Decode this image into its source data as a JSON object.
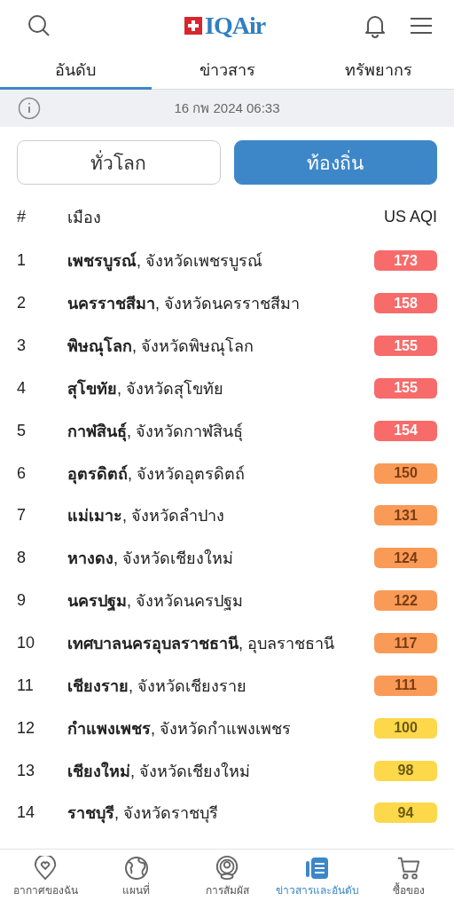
{
  "header": {
    "logo": "IQAir"
  },
  "tabs": [
    {
      "label": "อันดับ",
      "selected": true
    },
    {
      "label": "ข่าวสาร",
      "selected": false
    },
    {
      "label": "ทรัพยากร",
      "selected": false
    }
  ],
  "timestamp": "16 กพ 2024 06:33",
  "scope_toggle": [
    {
      "label": "ทั่วโลก",
      "selected": false
    },
    {
      "label": "ท้องถิ่น",
      "selected": true
    }
  ],
  "table": {
    "columns": [
      "#",
      "เมือง",
      "US AQI"
    ],
    "rows": [
      {
        "rank": "1",
        "city": "**เพชรบูรณ์**, จังหวัดเพชรบูรณ์",
        "aqi": "173",
        "color": "#f76b6b"
      },
      {
        "rank": "2",
        "city": "**นครราชสีมา**, จังหวัดนครราชสีมา",
        "aqi": "158",
        "color": "#f76b6b"
      },
      {
        "rank": "3",
        "city": "**พิษณุโลก**, จังหวัดพิษณุโลก",
        "aqi": "155",
        "color": "#f76b6b"
      },
      {
        "rank": "4",
        "city": "**สุโขทัย**, จังหวัดสุโขทัย",
        "aqi": "155",
        "color": "#f76b6b"
      },
      {
        "rank": "5",
        "city": "**กาฬสินธุ์**, จังหวัดกาฬสินธุ์",
        "aqi": "154",
        "color": "#f76b6b"
      },
      {
        "rank": "6",
        "city": "**อุตรดิตถ์**, จังหวัดอุตรดิตถ์",
        "aqi": "150",
        "color": "#fa9a57"
      },
      {
        "rank": "7",
        "city": "**แม่เมาะ**, จังหวัดลำปาง",
        "aqi": "131",
        "color": "#fa9a57"
      },
      {
        "rank": "8",
        "city": "**หางดง**, จังหวัดเชียงใหม่",
        "aqi": "124",
        "color": "#fa9a57"
      },
      {
        "rank": "9",
        "city": "**นครปฐม**, จังหวัดนครปฐม",
        "aqi": "122",
        "color": "#fa9a57"
      },
      {
        "rank": "10",
        "city": "**เทศบาลนครอุบลราชธานี**, อุบลราชธานี",
        "aqi": "117",
        "color": "#fa9a57"
      },
      {
        "rank": "11",
        "city": "**เชียงราย**, จังหวัดเชียงราย",
        "aqi": "111",
        "color": "#fa9a57"
      },
      {
        "rank": "12",
        "city": "**กำแพงเพชร**, จังหวัดกำแพงเพชร",
        "aqi": "100",
        "color": "#fcd84a"
      },
      {
        "rank": "13",
        "city": "**เชียงใหม่**, จังหวัดเชียงใหม่",
        "aqi": "98",
        "color": "#fcd84a"
      },
      {
        "rank": "14",
        "city": "**ราชบุรี**, จังหวัดราชบุรี",
        "aqi": "94",
        "color": "#fcd84a"
      }
    ]
  },
  "bottom_nav": [
    {
      "label": "อากาศของฉัน",
      "selected": false
    },
    {
      "label": "แผนที่",
      "selected": false
    },
    {
      "label": "การสัมผัส",
      "selected": false
    },
    {
      "label": "ข่าวสารและอันดับ",
      "selected": true
    },
    {
      "label": "ซื้อของ",
      "selected": false
    }
  ]
}
